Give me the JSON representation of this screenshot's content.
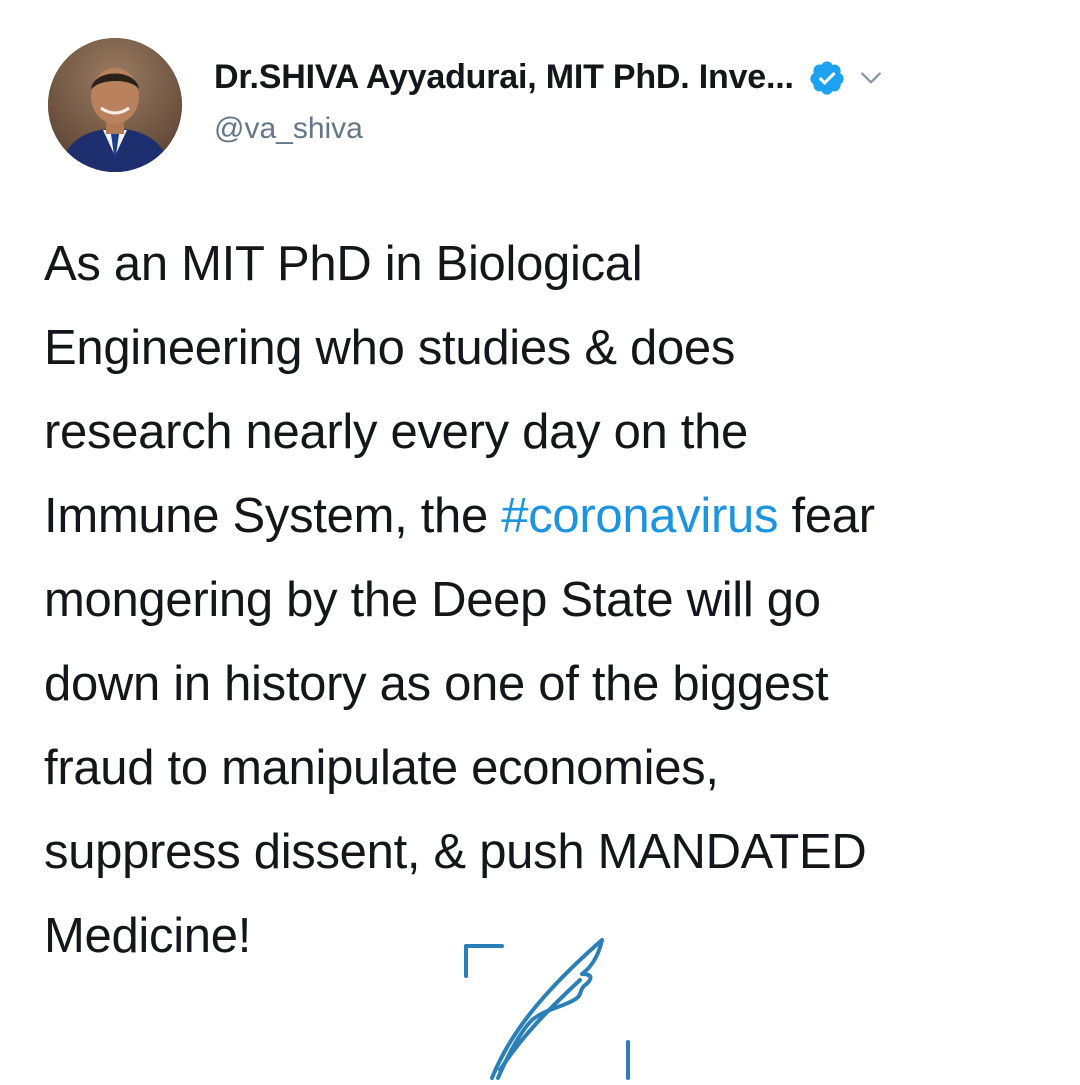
{
  "tweet": {
    "author": {
      "display_name": "Dr.SHIVA Ayyadurai, MIT PhD. Inve...",
      "handle": "@va_shiva",
      "verified": true,
      "avatar_icon": "profile-photo"
    },
    "menu_icon": "chevron-down-icon",
    "verified_icon": "verified-badge-icon",
    "body": {
      "line1": "As an MIT PhD in Biological",
      "line2": "Engineering who studies & does",
      "line3": "research nearly every day on the",
      "line4_before": "Immune System, the ",
      "hashtag": "#coronavirus",
      "line4_after": " fear",
      "line5": "mongering by the Deep State will go",
      "line6": "down in history as one of the biggest",
      "line7": "fraud to manipulate economies,",
      "line8": "suppress dissent, & push MANDATED",
      "line9": "Medicine!"
    },
    "watermark_icon": "feather-quill-icon"
  },
  "colors": {
    "text": "#14171a",
    "secondary": "#657786",
    "link": "#1b95e0",
    "verified": "#1da1f2",
    "watermark": "#2a7fb8"
  }
}
